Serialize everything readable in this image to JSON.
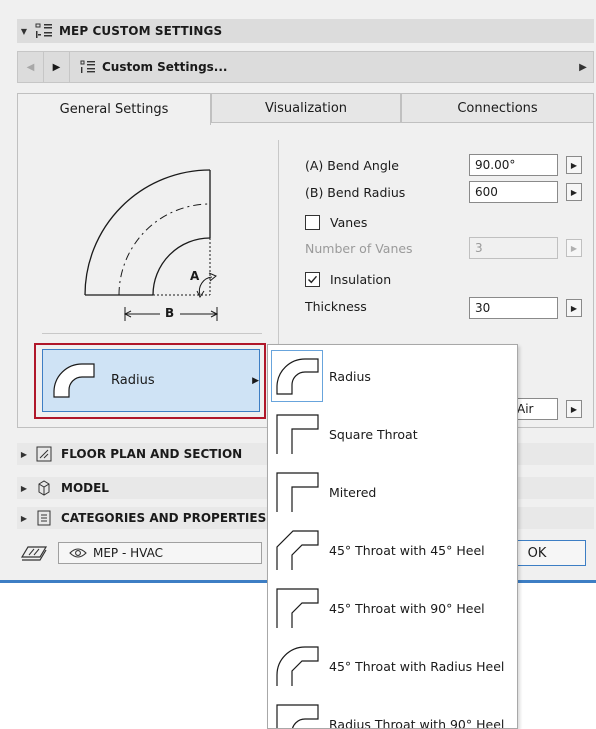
{
  "panel": {
    "section_title": "MEP CUSTOM SETTINGS",
    "nav": {
      "label": "Custom Settings..."
    }
  },
  "tabs": [
    {
      "label": "General Settings",
      "active": true
    },
    {
      "label": "Visualization",
      "active": false
    },
    {
      "label": "Connections",
      "active": false
    }
  ],
  "diagram": {
    "label_a": "A",
    "label_b": "B"
  },
  "params": {
    "bend_angle": {
      "label": "(A) Bend Angle",
      "value": "90.00°"
    },
    "bend_radius": {
      "label": "(B) Bend Radius",
      "value": "600"
    },
    "vanes": {
      "label": "Vanes",
      "checked": false
    },
    "number_of_vanes": {
      "label": "Number of Vanes",
      "value": "3"
    },
    "insulation": {
      "label": "Insulation",
      "checked": true
    },
    "thickness": {
      "label": "Thickness",
      "value": "30"
    },
    "air_value": "Air"
  },
  "type_selector": {
    "label": "Radius"
  },
  "sections": [
    {
      "label": "FLOOR PLAN AND SECTION",
      "icon": "floor-plan-icon"
    },
    {
      "label": "MODEL",
      "icon": "cube-icon"
    },
    {
      "label": "CATEGORIES AND PROPERTIES",
      "icon": "list-icon"
    }
  ],
  "status": {
    "layer": "MEP - HVAC",
    "ok_label": "OK"
  },
  "dropdown": {
    "items": [
      {
        "label": "Radius",
        "icon": "radius-icon",
        "selected": true
      },
      {
        "label": "Square Throat",
        "icon": "square-throat-icon",
        "selected": false
      },
      {
        "label": "Mitered",
        "icon": "mitered-icon",
        "selected": false
      },
      {
        "label": "45° Throat with 45° Heel",
        "icon": "throat45-heel45-icon",
        "selected": false
      },
      {
        "label": "45° Throat with 90° Heel",
        "icon": "throat45-heel90-icon",
        "selected": false
      },
      {
        "label": "45° Throat with Radius Heel",
        "icon": "throat45-radius-heel-icon",
        "selected": false
      },
      {
        "label": "Radius Throat with 90° Heel",
        "icon": "radius-throat-heel90-icon",
        "selected": false
      }
    ]
  },
  "colors": {
    "accent": "#3d7ec4",
    "highlight_frame": "#b0172a",
    "selected_bg": "#cfe3f5"
  }
}
